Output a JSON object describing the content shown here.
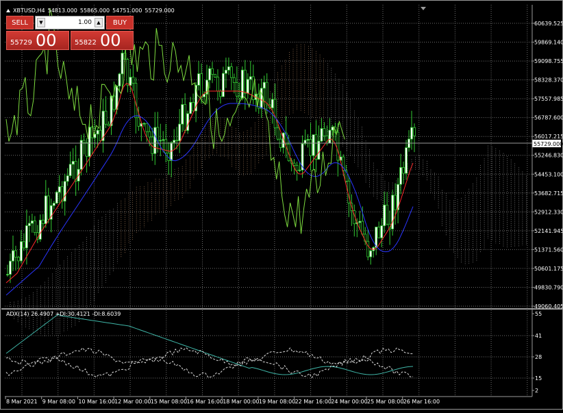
{
  "header": {
    "symbol": "XBTUSD,H4",
    "open": "54813.000",
    "high": "55865.000",
    "low": "54751.000",
    "close": "55729.000"
  },
  "trade_panel": {
    "sell_label": "SELL",
    "buy_label": "BUY",
    "volume_value": "1.00",
    "sell_price_small": "55729",
    "sell_price_big": "00",
    "buy_price_small": "55822",
    "buy_price_big": "00",
    "down_arrow_icon": "triangle-down-icon",
    "up_arrow_icon": "triangle-up-icon"
  },
  "price_axis": {
    "labels": [
      "60639.525",
      "59869.140",
      "59098.755",
      "58328.370",
      "57557.985",
      "56787.600",
      "56017.215",
      "55246.830",
      "54453.100",
      "53682.715",
      "52912.330",
      "52141.945",
      "51371.560",
      "50601.175",
      "49830.790",
      "49060.405"
    ],
    "current_price": "55729.000"
  },
  "adx_panel": {
    "label": "ADX(14) 26.4907 +DI:30.4121 -DI:8.6039",
    "axis_labels": [
      "55",
      "41",
      "28",
      "15",
      "2"
    ]
  },
  "time_axis": {
    "labels": [
      "8 Mar 2021",
      "9 Mar 08:00",
      "10 Mar 16:00",
      "12 Mar 00:00",
      "15 Mar 08:00",
      "16 Mar 16:00",
      "18 Mar 00:00",
      "19 Mar 08:00",
      "22 Mar 16:00",
      "24 Mar 00:00",
      "25 Mar 08:00",
      "26 Mar 16:00"
    ]
  },
  "colors": {
    "background": "#000000",
    "grid": "#6e6e6e",
    "bull_candle": "#ffffff",
    "bear_candle": "#000000",
    "candle_outline": "#33cc33",
    "tenkan": "#ff2a2a",
    "kijun": "#2a35ff",
    "chikou": "#7ddc3f",
    "cloud_a": "#ffc08a",
    "cloud_b": "#dddddd",
    "adx_main": "#3fb6a8",
    "sell_button": "#c8312a"
  }
}
